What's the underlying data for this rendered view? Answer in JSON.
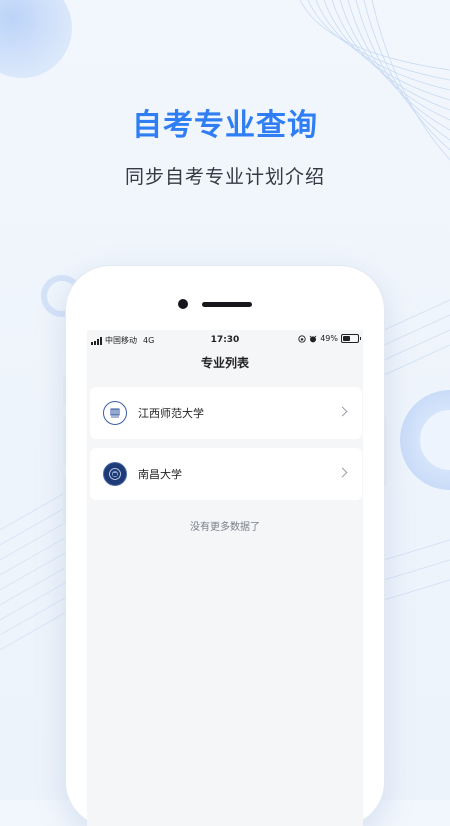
{
  "hero": {
    "title": "自考专业查询",
    "subtitle": "同步自考专业计划介绍"
  },
  "status_bar": {
    "carrier": "中国移动",
    "network": "4G",
    "time": "17:30",
    "battery": "49%",
    "battery_level": 0.49,
    "icons": [
      "signal-icon",
      "lock-rotation-icon",
      "alarm-icon",
      "battery-icon"
    ]
  },
  "nav": {
    "title": "专业列表"
  },
  "list": {
    "items": [
      {
        "name": "江西师范大学",
        "logo": "jxnu-logo-icon"
      },
      {
        "name": "南昌大学",
        "logo": "ncu-logo-icon"
      }
    ],
    "end_text": "没有更多数据了"
  },
  "colors": {
    "accent": "#2f7ef3",
    "background": "#f2f7fd",
    "screen_bg": "#f5f6f8"
  }
}
